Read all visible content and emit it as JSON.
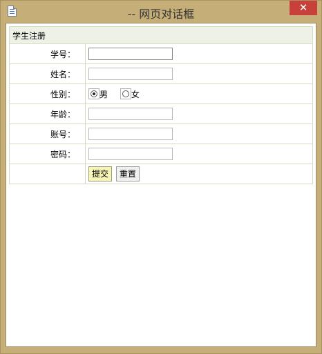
{
  "window": {
    "title": "-- 网页对话框",
    "close_glyph": "✕"
  },
  "form": {
    "header": "学生注册",
    "fields": {
      "student_id": {
        "label": "学号：",
        "value": ""
      },
      "name": {
        "label": "姓名：",
        "value": ""
      },
      "gender": {
        "label": "性别：",
        "options": [
          "男",
          "女"
        ],
        "selected": "男"
      },
      "age": {
        "label": "年龄：",
        "value": ""
      },
      "account": {
        "label": "账号：",
        "value": ""
      },
      "password": {
        "label": "密码：",
        "value": ""
      }
    },
    "buttons": {
      "submit": "提交",
      "reset": "重置"
    }
  }
}
